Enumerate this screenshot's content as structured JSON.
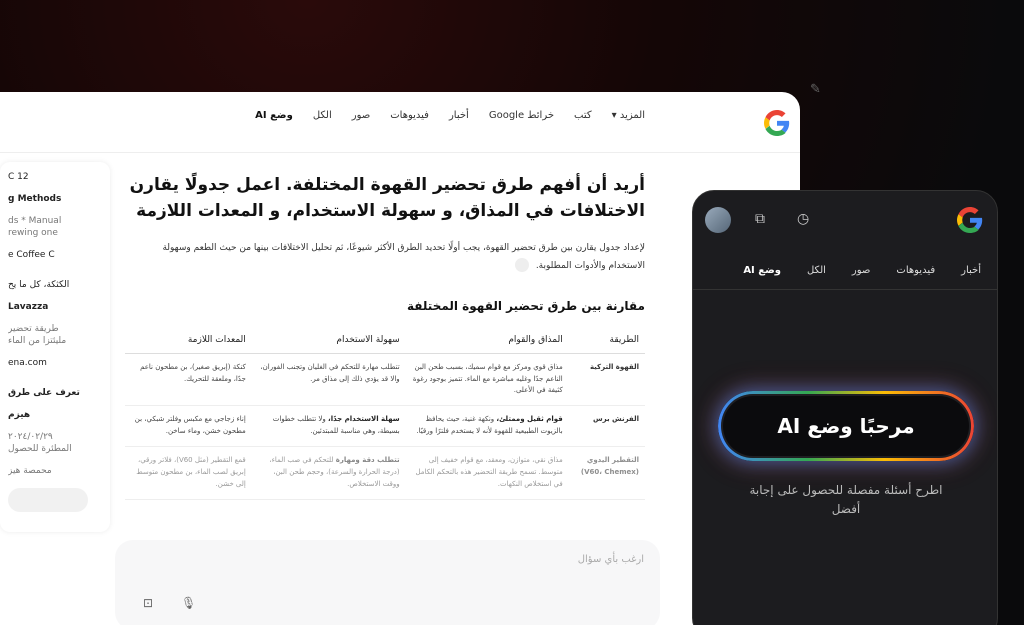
{
  "desktop": {
    "nav": {
      "tabs": [
        "وضع AI",
        "الكل",
        "صور",
        "فيديوهات",
        "أخبار",
        "خرائط Google",
        "كتب",
        "المزيد ▾"
      ]
    },
    "left_card": {
      "lines": [
        "C  12",
        "g Methods",
        "ds * Manual",
        "rewing one",
        "e Coffee  C",
        "الكثكة، كل ما يح",
        "Lavazza",
        "طريقة تحضير",
        "مليئتزا من الماء",
        "ena.com",
        "تعرف على طرق",
        "هيزم",
        "٢٠٢٤/٠٢/٢٩",
        "المطئرة للحصول",
        "محمصة هيز"
      ]
    },
    "question": "أريد أن أفهم طرق تحضير القهوة المختلفة. اعمل جدولًا يقارن الاختلافات في المذاق، و سهولة الاستخدام، و المعدات اللازمة",
    "intro": "لإعداد جدول يقارن بين طرق تحضير القهوة، يجب أولًا تحديد الطرق الأكثر شيوعًا، ثم تحليل الاختلافات بينها من حيث الطعم وسهولة الاستخدام والأدوات المطلوبة.",
    "table_title": "مقارنة بين طرق تحضير القهوة المختلفة",
    "table": {
      "headers": [
        "الطريقة",
        "المذاق والقوام",
        "سهولة الاستخدام",
        "المعدات اللازمة"
      ],
      "rows": [
        {
          "method": "القهوة التركية",
          "taste": "مذاق قوي ومركز مع قوام سميك، بسبب طحن البن الناعم جدًا وغليه مباشرة مع الماء. تتميز بوجود رغوة كثيفة في الأعلى.",
          "ease": "تتطلب مهارة للتحكم في الغليان وتجنب الفوران، والا قد يؤدي ذلك إلى مذاق مر.",
          "equipment": "كنكة (إبريق صغير)، بن مطحون ناعم جدًا، وملعقة للتحريك."
        },
        {
          "method": "الفرنش برس",
          "taste_bold": "قوام ثقيل وممتلئ،",
          "taste": "ونكهة غنية، حيث يحافظ بالزيوت الطبيعية للقهوة لأنه لا يستخدم فلترًا ورقيًا.",
          "ease_bold": "سهلة الاستخدام جدًا،",
          "ease": "ولا تتطلب خطوات بسيطة، وهي مناسبة للمبتدئين.",
          "equipment": "إناء زجاجي مع مكبس وفلتر شبكي، بن مطحون خشن، وماء ساخن."
        },
        {
          "method": "التقطير اليدوي (V60، Chemex)",
          "taste": "مذاق نقي، متوازن، ومعقد، مع قوام خفيف إلى متوسط. تسمح طريقة التحضير هذه بالتحكم الكامل في استخلاص النكهات.",
          "ease_bold": "تتطلب دقة ومهارة",
          "ease": "للتحكم في صب الماء، (درجة الحرارة والسرعة)، وحجم طحن البن، ووقت الاستخلاص.",
          "equipment": "قمع التقطير (مثل V60)، فلاتر ورقي، إبريق لصب الماء، بن مطحون متوسط إلى خشن."
        }
      ]
    },
    "ask_placeholder": "ارغب بأي سؤال"
  },
  "mobile": {
    "tabs": [
      "وضع AI",
      "الكل",
      "صور",
      "فيديوهات",
      "أخبار"
    ],
    "ai_welcome": "مرحبًا وضع AI",
    "subtitle": "اطرح أسئلة مفصلة للحصول على إجابة أفضل"
  },
  "colors": {
    "google_blue": "#4285F4",
    "google_red": "#EA4335",
    "google_yellow": "#FBBC05",
    "google_green": "#34A853"
  },
  "icons": [
    "google-logo-icon",
    "new-chat-icon",
    "history-icon",
    "avatar-icon",
    "mic-icon",
    "camera-icon",
    "link-icon"
  ]
}
